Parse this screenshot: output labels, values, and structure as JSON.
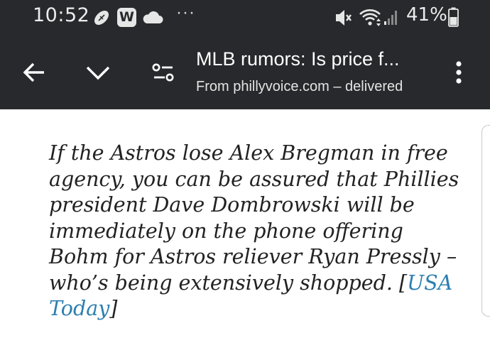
{
  "status_bar": {
    "time": "10:52",
    "more_notifications": "···",
    "w_badge": "W",
    "battery_percent": "41%",
    "icons": [
      "football-icon",
      "w-app-icon",
      "cloud-icon",
      "more-notifications-icon",
      "mute-icon",
      "wifi-icon",
      "signal-icon",
      "battery-icon"
    ]
  },
  "toolbar": {
    "title": "MLB rumors: Is price f...",
    "subtitle": "From phillyvoice.com – delivered",
    "icons": [
      "back-arrow-icon",
      "chevron-down-icon",
      "page-settings-icon",
      "more-vert-icon"
    ]
  },
  "article": {
    "quote_text": "If the Astros lose Alex Bregman in free agency, you can be assured that Phillies president Dave Dombrowski will be immediately on the phone offering Bohm for Astros reliever Ryan Pressly – who’s being extensively shopped. ",
    "bracket_open": "[",
    "link_text": "USA Today",
    "bracket_close": "]"
  },
  "colors": {
    "bar_background": "#27292c",
    "link": "#2c7fb0",
    "body_text": "#222222"
  }
}
